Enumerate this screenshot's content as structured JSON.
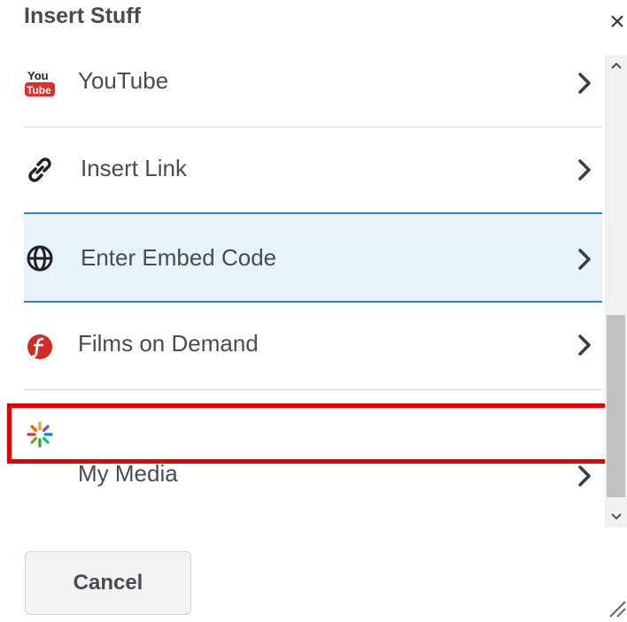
{
  "dialog": {
    "title": "Insert Stuff",
    "close_label": "×"
  },
  "items": [
    {
      "label": "YouTube",
      "icon": "youtube-icon"
    },
    {
      "label": "Insert Link",
      "icon": "link-icon"
    },
    {
      "label": "Enter Embed Code",
      "icon": "globe-icon",
      "selected": true
    },
    {
      "label": "Films on Demand",
      "icon": "films-on-demand-icon"
    },
    {
      "label": "My Media",
      "icon": "my-media-icon",
      "highlighted": true
    }
  ],
  "youtube_logo": {
    "top": "You",
    "bottom": "Tube"
  },
  "footer": {
    "cancel_label": "Cancel"
  },
  "colors": {
    "selected_bg": "#e8f3f9",
    "selected_border": "#2e86c1",
    "highlight": "#e60000",
    "youtube_red": "#e52d27",
    "films_red": "#d42a1f"
  }
}
